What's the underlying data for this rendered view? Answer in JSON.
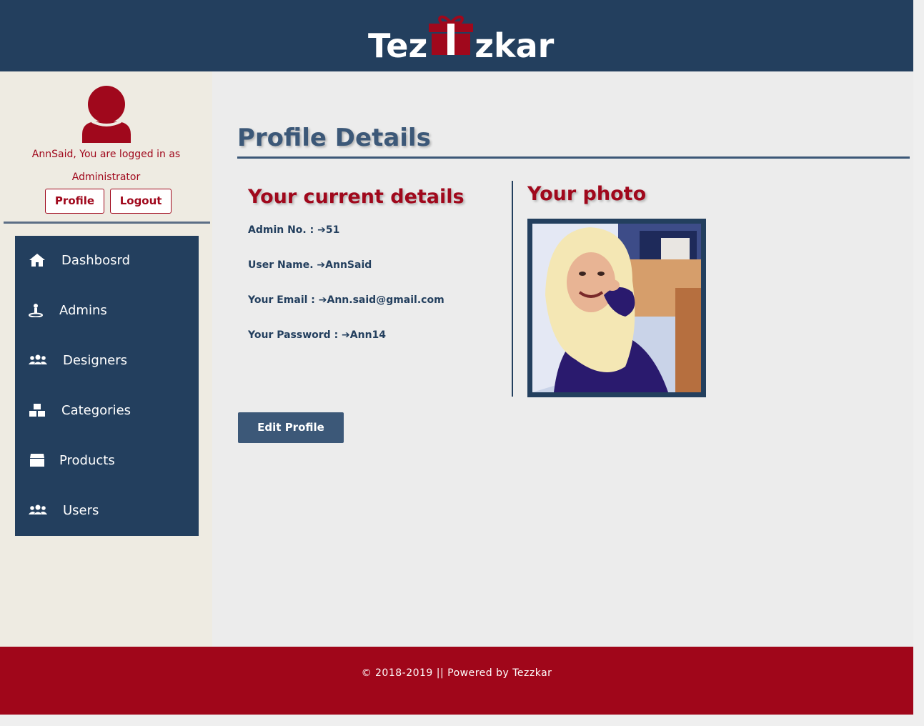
{
  "header": {
    "logo_left": "Tez",
    "logo_right": "zkar"
  },
  "sidebar": {
    "logged_in_line1": "AnnSaid, You are logged in as",
    "logged_in_line2": "Administrator",
    "profile_label": "Profile",
    "logout_label": "Logout",
    "nav": [
      {
        "label": "Dashbosrd",
        "icon": "home-icon"
      },
      {
        "label": "Admins",
        "icon": "admin-icon"
      },
      {
        "label": "Designers",
        "icon": "users-group-icon"
      },
      {
        "label": "Categories",
        "icon": "boxes-icon"
      },
      {
        "label": "Products",
        "icon": "box-icon"
      },
      {
        "label": "Users",
        "icon": "users-group-icon"
      }
    ]
  },
  "main": {
    "page_title": "Profile Details",
    "details_title": "Your current details",
    "details": [
      {
        "label": "Admin No. :",
        "value": "51"
      },
      {
        "label": "User Name.",
        "value": "AnnSaid"
      },
      {
        "label": "Your Email :",
        "value": "Ann.said@gmail.com"
      },
      {
        "label": "Your Password :",
        "value": "Ann14"
      }
    ],
    "photo_title": "Your photo",
    "edit_label": "Edit Profile"
  },
  "footer": {
    "text": "© 2018-2019 || Powered by Tezzkar"
  },
  "colors": {
    "navy": "#233f5e",
    "crimson": "#a0081c",
    "slate": "#3c5878"
  }
}
